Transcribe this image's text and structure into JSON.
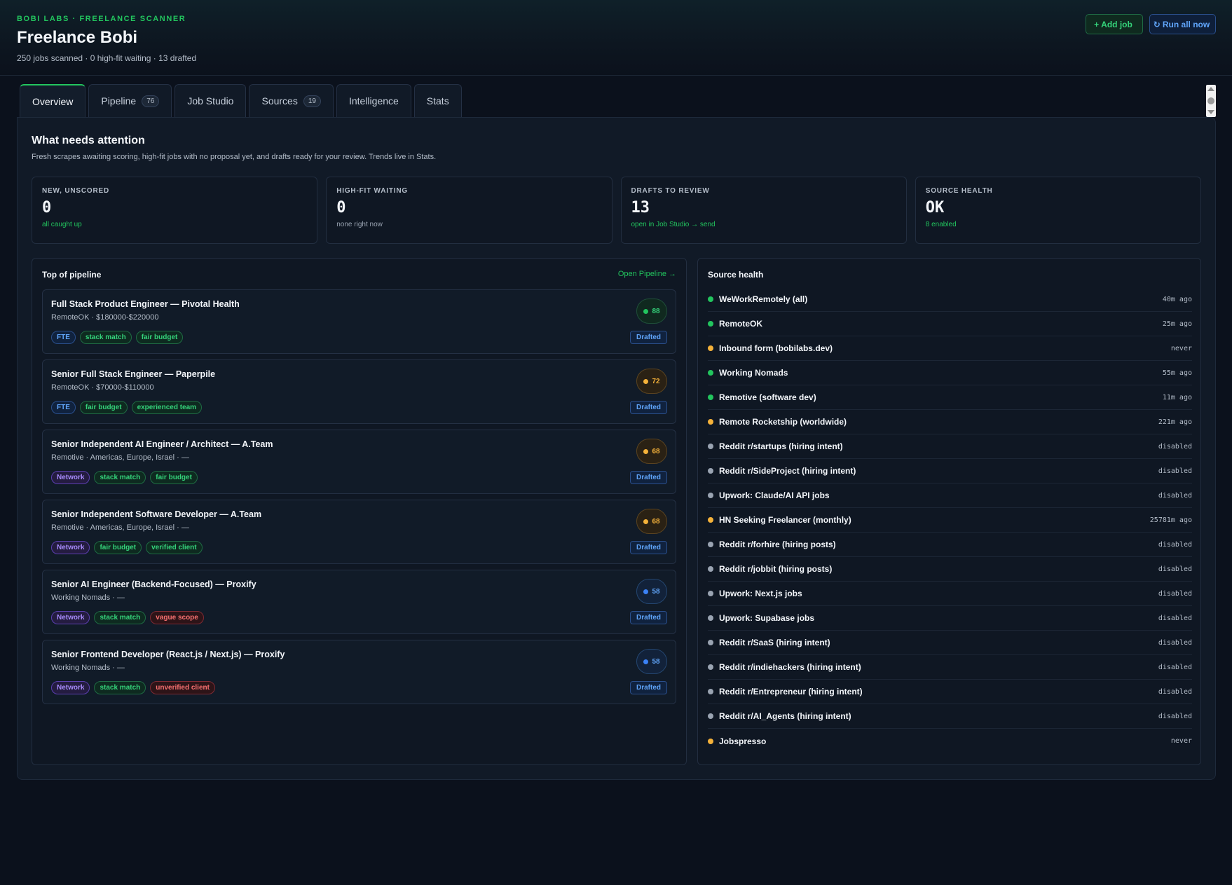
{
  "header": {
    "eyebrow": "BOBI LABS · FREELANCE SCANNER",
    "title": "Freelance Bobi",
    "subtitle": "250 jobs scanned · 0 high-fit waiting · 13 drafted",
    "add_job_label": "Add job",
    "run_all_label": "Run all now",
    "add_icon": "+",
    "run_icon": "↻"
  },
  "tabs": [
    {
      "label": "Overview",
      "count": ""
    },
    {
      "label": "Pipeline",
      "count": "76"
    },
    {
      "label": "Job Studio",
      "count": ""
    },
    {
      "label": "Sources",
      "count": "19"
    },
    {
      "label": "Intelligence",
      "count": ""
    },
    {
      "label": "Stats",
      "count": ""
    }
  ],
  "attention": {
    "title": "What needs attention",
    "description": "Fresh scrapes awaiting scoring, high-fit jobs with no proposal yet, and drafts ready for your review. Trends live in Stats."
  },
  "stats": [
    {
      "label": "NEW, UNSCORED",
      "value": "0",
      "note": "all caught up",
      "tone": "green"
    },
    {
      "label": "HIGH-FIT WAITING",
      "value": "0",
      "note": "none right now",
      "tone": "muted"
    },
    {
      "label": "DRAFTS TO REVIEW",
      "value": "13",
      "note": "open in Job Studio → send",
      "tone": "green"
    },
    {
      "label": "SOURCE HEALTH",
      "value": "OK",
      "note": "8 enabled",
      "tone": "green"
    }
  ],
  "pipeline": {
    "title": "Top of pipeline",
    "open_label": "Open Pipeline →",
    "jobs": [
      {
        "title": "Full Stack Product Engineer — Pivotal Health",
        "meta": "RemoteOK · $180000-$220000",
        "score": "88",
        "score_tone": "green",
        "status": "Drafted",
        "tags": [
          {
            "label": "FTE",
            "tone": "blue"
          },
          {
            "label": "stack match",
            "tone": "green"
          },
          {
            "label": "fair budget",
            "tone": "green"
          }
        ]
      },
      {
        "title": "Senior Full Stack Engineer — Paperpile",
        "meta": "RemoteOK · $70000-$110000",
        "score": "72",
        "score_tone": "amber",
        "status": "Drafted",
        "tags": [
          {
            "label": "FTE",
            "tone": "blue"
          },
          {
            "label": "fair budget",
            "tone": "green"
          },
          {
            "label": "experienced team",
            "tone": "green"
          }
        ]
      },
      {
        "title": "Senior Independent AI Engineer / Architect — A.Team",
        "meta": "Remotive · Americas, Europe, Israel · —",
        "score": "68",
        "score_tone": "amber",
        "status": "Drafted",
        "tags": [
          {
            "label": "Network",
            "tone": "purple"
          },
          {
            "label": "stack match",
            "tone": "green"
          },
          {
            "label": "fair budget",
            "tone": "green"
          }
        ]
      },
      {
        "title": "Senior Independent Software Developer — A.Team",
        "meta": "Remotive · Americas, Europe, Israel · —",
        "score": "68",
        "score_tone": "amber",
        "status": "Drafted",
        "tags": [
          {
            "label": "Network",
            "tone": "purple"
          },
          {
            "label": "fair budget",
            "tone": "green"
          },
          {
            "label": "verified client",
            "tone": "green"
          }
        ]
      },
      {
        "title": "Senior AI Engineer (Backend-Focused) — Proxify",
        "meta": "Working Nomads · —",
        "score": "58",
        "score_tone": "blue",
        "status": "Drafted",
        "tags": [
          {
            "label": "Network",
            "tone": "purple"
          },
          {
            "label": "stack match",
            "tone": "green"
          },
          {
            "label": "vague scope",
            "tone": "red"
          }
        ]
      },
      {
        "title": "Senior Frontend Developer (React.js / Next.js) — Proxify",
        "meta": "Working Nomads · —",
        "score": "58",
        "score_tone": "blue",
        "status": "Drafted",
        "tags": [
          {
            "label": "Network",
            "tone": "purple"
          },
          {
            "label": "stack match",
            "tone": "green"
          },
          {
            "label": "unverified client",
            "tone": "red"
          }
        ]
      }
    ]
  },
  "source_health": {
    "title": "Source health",
    "sources": [
      {
        "name": "WeWorkRemotely (all)",
        "time": "40m ago",
        "status": "green"
      },
      {
        "name": "RemoteOK",
        "time": "25m ago",
        "status": "green"
      },
      {
        "name": "Inbound form (bobilabs.dev)",
        "time": "never",
        "status": "amber"
      },
      {
        "name": "Working Nomads",
        "time": "55m ago",
        "status": "green"
      },
      {
        "name": "Remotive (software dev)",
        "time": "11m ago",
        "status": "green"
      },
      {
        "name": "Remote Rocketship (worldwide)",
        "time": "221m ago",
        "status": "amber"
      },
      {
        "name": "Reddit r/startups (hiring intent)",
        "time": "disabled",
        "status": "grey"
      },
      {
        "name": "Reddit r/SideProject (hiring intent)",
        "time": "disabled",
        "status": "grey"
      },
      {
        "name": "Upwork: Claude/AI API jobs",
        "time": "disabled",
        "status": "grey"
      },
      {
        "name": "HN Seeking Freelancer (monthly)",
        "time": "25781m ago",
        "status": "amber"
      },
      {
        "name": "Reddit r/forhire (hiring posts)",
        "time": "disabled",
        "status": "grey"
      },
      {
        "name": "Reddit r/jobbit (hiring posts)",
        "time": "disabled",
        "status": "grey"
      },
      {
        "name": "Upwork: Next.js jobs",
        "time": "disabled",
        "status": "grey"
      },
      {
        "name": "Upwork: Supabase jobs",
        "time": "disabled",
        "status": "grey"
      },
      {
        "name": "Reddit r/SaaS (hiring intent)",
        "time": "disabled",
        "status": "grey"
      },
      {
        "name": "Reddit r/indiehackers (hiring intent)",
        "time": "disabled",
        "status": "grey"
      },
      {
        "name": "Reddit r/Entrepreneur (hiring intent)",
        "time": "disabled",
        "status": "grey"
      },
      {
        "name": "Reddit r/AI_Agents (hiring intent)",
        "time": "disabled",
        "status": "grey"
      },
      {
        "name": "Jobspresso",
        "time": "never",
        "status": "amber"
      }
    ]
  }
}
